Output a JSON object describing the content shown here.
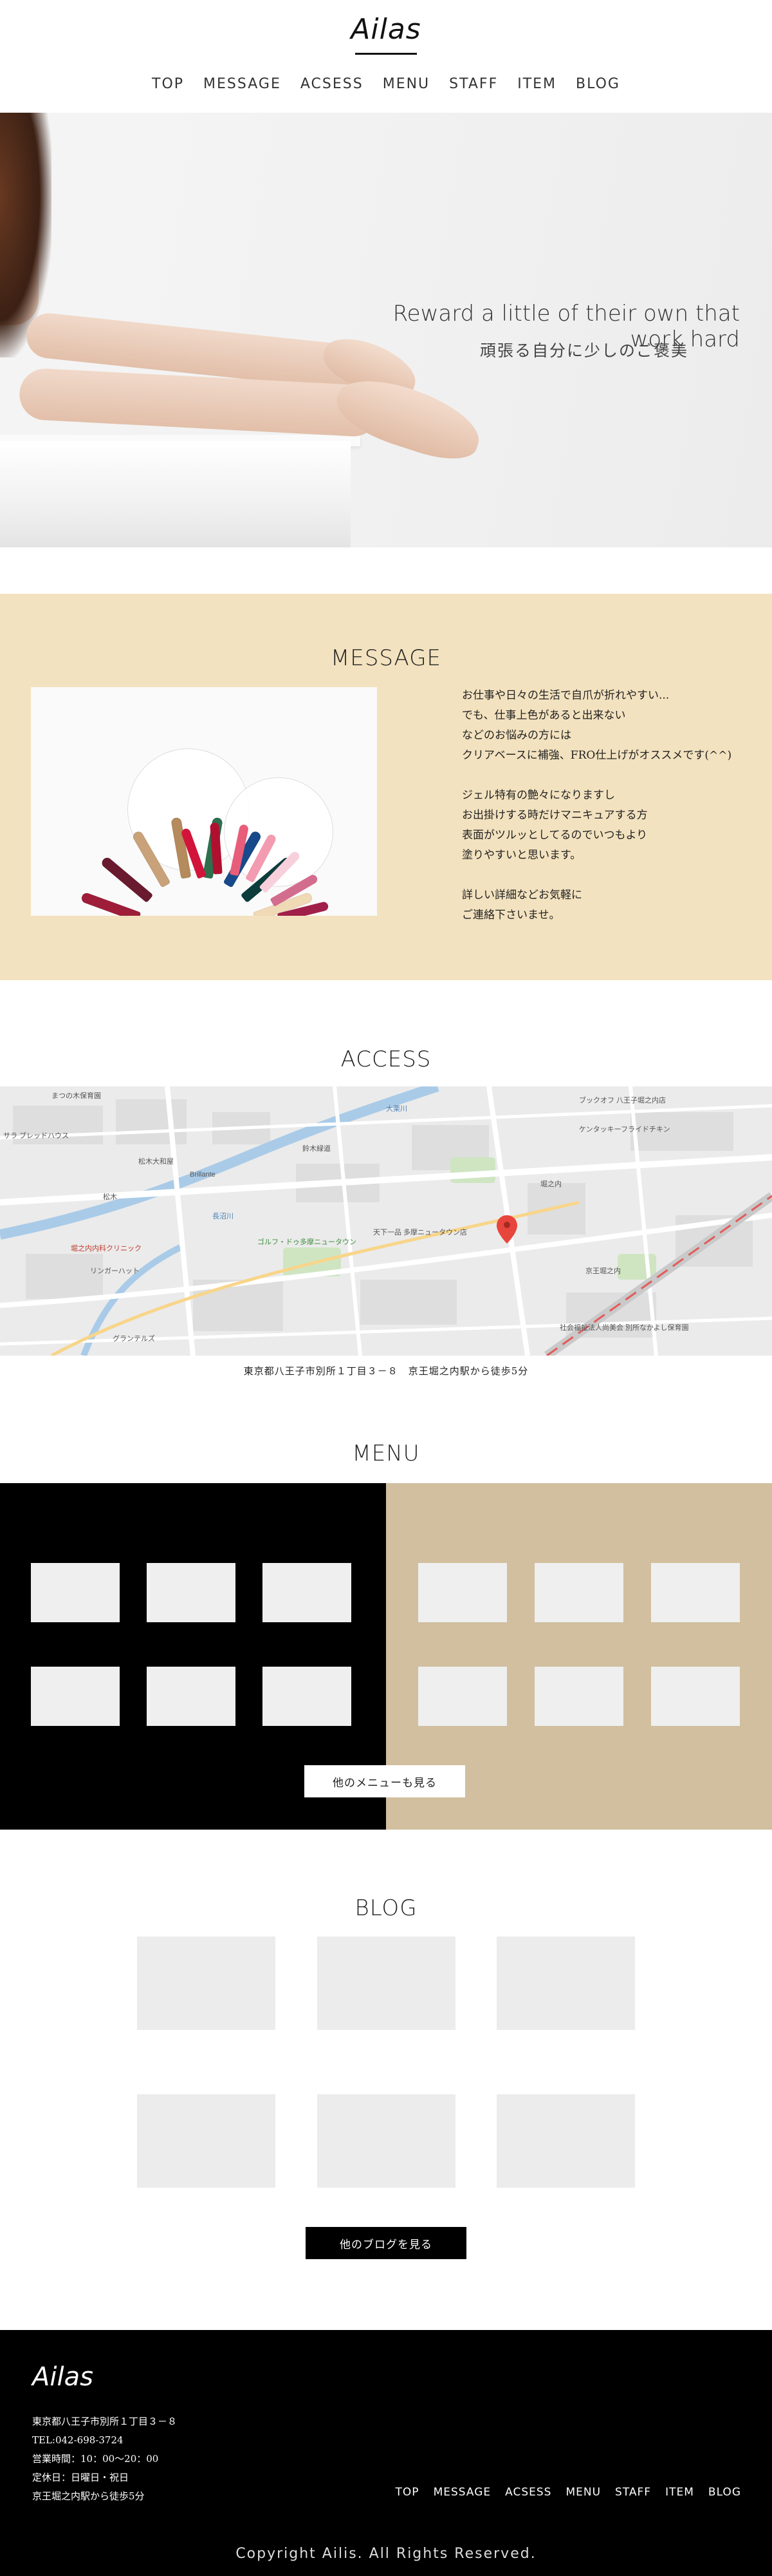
{
  "header": {
    "logo": "Ailas",
    "nav": [
      "TOP",
      "MESSAGE",
      "ACSESS",
      "MENU",
      "STAFF",
      "ITEM",
      "BLOG"
    ]
  },
  "hero": {
    "title": "Reward a little of their own that work hard",
    "subtitle": "頑張る自分に少しのご褒美"
  },
  "message": {
    "title": "MESSAGE",
    "lines": [
      "お仕事や日々の生活で自爪が折れやすい...",
      "でも、仕事上色があると出来ない",
      "などのお悩みの方には",
      "クリアベースに補強、FRO仕上げがオススメです(^^)",
      "",
      "ジェル特有の艶々になりますし",
      "お出掛けする時だけマニキュアする方",
      "表面がツルッとしてるのでいつもより",
      "塗りやすいと思います。",
      "",
      "詳しい詳細などお気軽に",
      "ご連絡下さいませ。"
    ]
  },
  "access": {
    "title": "ACCESS",
    "address": "東京都八王子市別所１丁目３－８　京王堀之内駅から徒歩5分",
    "map_labels": [
      "まつの木保育園",
      "サラ ブレッドハウス",
      "松木",
      "Brillante",
      "松木大和屋",
      "鈴木緑道",
      "ゴルフ・ドゥ多摩ニュータウン",
      "長沼川",
      "堀之内内科クリニック",
      "リンガーハット",
      "グランテルズ",
      "大栗川",
      "天下一品 多摩ニュータウン店",
      "堀之内",
      "京王堀之内",
      "ブックオフ 八王子堀之内店",
      "ケンタッキーフライドチキン",
      "社会福祉法人尚美会 別所なかよし保育園"
    ]
  },
  "menu": {
    "title": "MENU",
    "more_button": "他のメニューも見る"
  },
  "blog": {
    "title": "BLOG",
    "more_button": "他のブログを見る"
  },
  "footer": {
    "logo": "Ailas",
    "info": [
      "東京都八王子市別所１丁目３－８",
      "TEL:042-698-3724",
      "営業時間：10：00〜20：00",
      "定休日：日曜日・祝日",
      "京王堀之内駅から徒歩5分"
    ],
    "nav": [
      "TOP",
      "MESSAGE",
      "ACSESS",
      "MENU",
      "STAFF",
      "ITEM",
      "BLOG"
    ],
    "copyright": "Copyright Ailis. All Rights Reserved."
  },
  "colors": {
    "message_bg": "#f3e2bf",
    "menu_left": "#000000",
    "menu_right": "#d1bf9f",
    "footer_bg": "#000000"
  }
}
